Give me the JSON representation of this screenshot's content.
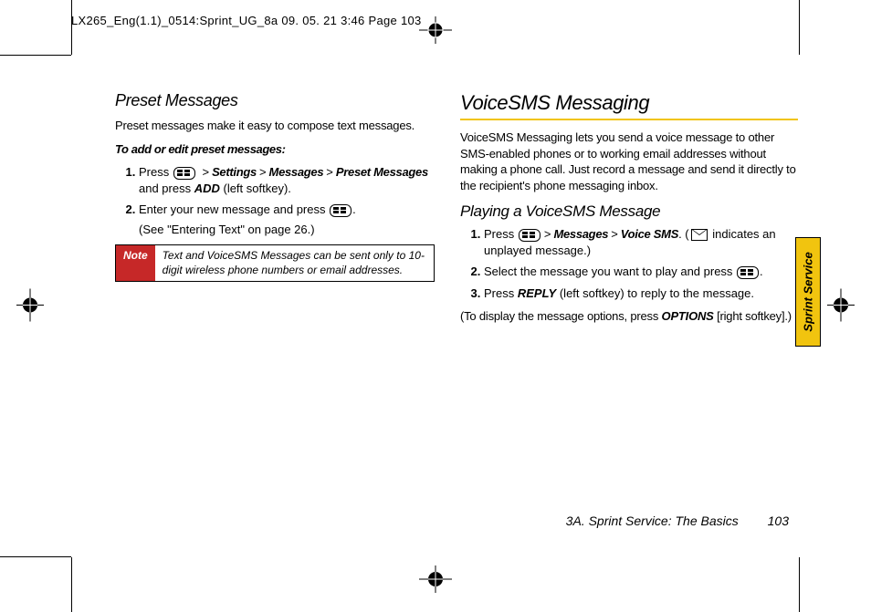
{
  "header_info": "LX265_Eng(1.1)_0514:Sprint_UG_8a  09. 05. 21    3:46  Page 103",
  "left": {
    "h_sub": "Preset Messages",
    "intro": "Preset messages make it easy to compose text messages.",
    "lead": "To add or edit preset messages:",
    "step1_a": "Press ",
    "step1_path1": "Settings",
    "step1_path2": "Messages",
    "step1_path3": "Preset Messages",
    "step1_b": " and press ",
    "step1_add": "ADD",
    "step1_c": " (left softkey).",
    "step2_a": "Enter your new message and press ",
    "step2_b": ".",
    "step2_c": "(See \"Entering Text\" on page 26.)",
    "note_label": "Note",
    "note_text": "Text and VoiceSMS Messages can be sent only to 10-digit wireless phone numbers or email addresses."
  },
  "right": {
    "h_section": "VoiceSMS Messaging",
    "intro": "VoiceSMS Messaging lets you send a voice message to other SMS-enabled phones or to working email addresses without making a phone call. Just record a message and send it directly to the recipient's phone messaging inbox.",
    "h_sub2": "Playing a VoiceSMS Message",
    "r1_a": "Press ",
    "r1_path1": "Messages",
    "r1_path2": "Voice SMS",
    "r1_b": ". (",
    "r1_c": " indicates an unplayed message.)",
    "r2_a": "Select the message you want to play and press ",
    "r2_b": ".",
    "r3_a": "Press ",
    "r3_reply": "REPLY",
    "r3_b": " (left softkey) to reply to the message.",
    "post_a": "(To display the message options, press ",
    "post_opt": "OPTIONS",
    "post_b": " [right softkey].)"
  },
  "side_tab": "Sprint Service",
  "footer_text": "3A. Sprint Service: The Basics",
  "footer_num": "103"
}
